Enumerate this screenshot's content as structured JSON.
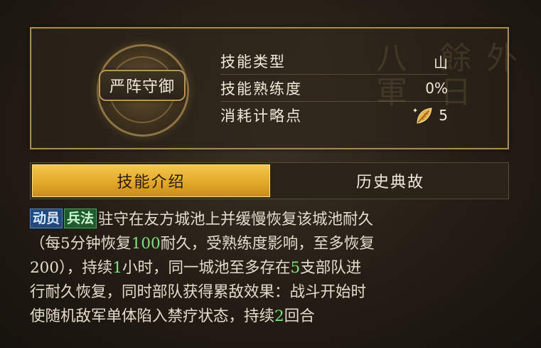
{
  "skill": {
    "name": "严阵守御",
    "stats": [
      {
        "label": "技能类型",
        "value": "山"
      },
      {
        "label": "技能熟练度",
        "value": "0%"
      },
      {
        "label": "消耗计略点",
        "value": "5",
        "icon": "golden-leaf-icon"
      }
    ]
  },
  "tabs": {
    "intro": "技能介绍",
    "history": "历史典故",
    "active": "intro"
  },
  "description": {
    "tags": [
      "动员",
      "兵法"
    ],
    "line1": "驻守在友方城池上并缓慢恢复该城池耐久",
    "line2_a": "（每5分钟恢复",
    "line2_num": "100",
    "line2_b": "耐久，受熟练度影响，至多恢复",
    "line3_a": "200），持续",
    "line3_num1": "1",
    "line3_b": "小时，同一城池至多存在",
    "line3_num2": "5",
    "line3_c": "支部队进",
    "line4": "行耐久恢复，同时部队获得累敌效果：战斗开始时",
    "line5_a": "使随机敌军单体陷入禁疗状态，持续",
    "line5_num": "2",
    "line5_b": "回合"
  },
  "colors": {
    "tab_active": "#e2a92a",
    "highlight_number": "#7ee07e",
    "tag_blue": "#1f4a7e",
    "tag_green": "#1f5a2f",
    "frame": "#a78a52"
  }
}
